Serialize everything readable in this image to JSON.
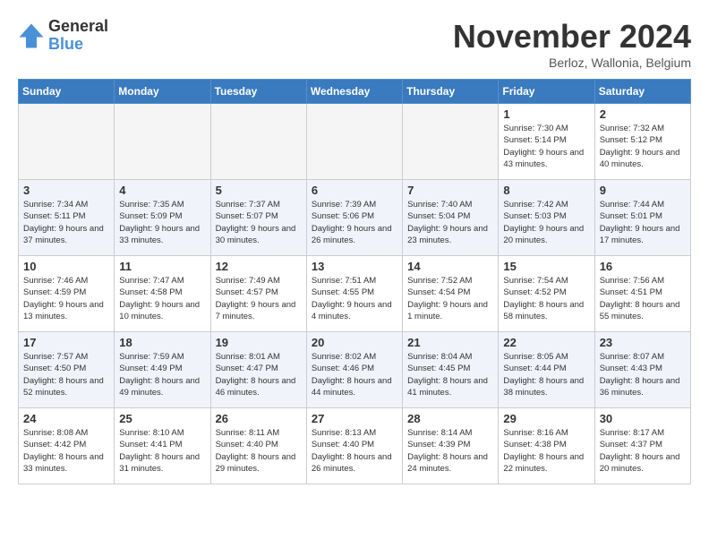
{
  "logo": {
    "general": "General",
    "blue": "Blue"
  },
  "title": {
    "month_year": "November 2024",
    "location": "Berloz, Wallonia, Belgium"
  },
  "weekdays": [
    "Sunday",
    "Monday",
    "Tuesday",
    "Wednesday",
    "Thursday",
    "Friday",
    "Saturday"
  ],
  "weeks": [
    [
      {
        "day": "",
        "empty": true
      },
      {
        "day": "",
        "empty": true
      },
      {
        "day": "",
        "empty": true
      },
      {
        "day": "",
        "empty": true
      },
      {
        "day": "",
        "empty": true
      },
      {
        "day": "1",
        "sunrise": "7:30 AM",
        "sunset": "5:14 PM",
        "daylight": "9 hours and 43 minutes."
      },
      {
        "day": "2",
        "sunrise": "7:32 AM",
        "sunset": "5:12 PM",
        "daylight": "9 hours and 40 minutes."
      }
    ],
    [
      {
        "day": "3",
        "sunrise": "7:34 AM",
        "sunset": "5:11 PM",
        "daylight": "9 hours and 37 minutes."
      },
      {
        "day": "4",
        "sunrise": "7:35 AM",
        "sunset": "5:09 PM",
        "daylight": "9 hours and 33 minutes."
      },
      {
        "day": "5",
        "sunrise": "7:37 AM",
        "sunset": "5:07 PM",
        "daylight": "9 hours and 30 minutes."
      },
      {
        "day": "6",
        "sunrise": "7:39 AM",
        "sunset": "5:06 PM",
        "daylight": "9 hours and 26 minutes."
      },
      {
        "day": "7",
        "sunrise": "7:40 AM",
        "sunset": "5:04 PM",
        "daylight": "9 hours and 23 minutes."
      },
      {
        "day": "8",
        "sunrise": "7:42 AM",
        "sunset": "5:03 PM",
        "daylight": "9 hours and 20 minutes."
      },
      {
        "day": "9",
        "sunrise": "7:44 AM",
        "sunset": "5:01 PM",
        "daylight": "9 hours and 17 minutes."
      }
    ],
    [
      {
        "day": "10",
        "sunrise": "7:46 AM",
        "sunset": "4:59 PM",
        "daylight": "9 hours and 13 minutes."
      },
      {
        "day": "11",
        "sunrise": "7:47 AM",
        "sunset": "4:58 PM",
        "daylight": "9 hours and 10 minutes."
      },
      {
        "day": "12",
        "sunrise": "7:49 AM",
        "sunset": "4:57 PM",
        "daylight": "9 hours and 7 minutes."
      },
      {
        "day": "13",
        "sunrise": "7:51 AM",
        "sunset": "4:55 PM",
        "daylight": "9 hours and 4 minutes."
      },
      {
        "day": "14",
        "sunrise": "7:52 AM",
        "sunset": "4:54 PM",
        "daylight": "9 hours and 1 minute."
      },
      {
        "day": "15",
        "sunrise": "7:54 AM",
        "sunset": "4:52 PM",
        "daylight": "8 hours and 58 minutes."
      },
      {
        "day": "16",
        "sunrise": "7:56 AM",
        "sunset": "4:51 PM",
        "daylight": "8 hours and 55 minutes."
      }
    ],
    [
      {
        "day": "17",
        "sunrise": "7:57 AM",
        "sunset": "4:50 PM",
        "daylight": "8 hours and 52 minutes."
      },
      {
        "day": "18",
        "sunrise": "7:59 AM",
        "sunset": "4:49 PM",
        "daylight": "8 hours and 49 minutes."
      },
      {
        "day": "19",
        "sunrise": "8:01 AM",
        "sunset": "4:47 PM",
        "daylight": "8 hours and 46 minutes."
      },
      {
        "day": "20",
        "sunrise": "8:02 AM",
        "sunset": "4:46 PM",
        "daylight": "8 hours and 44 minutes."
      },
      {
        "day": "21",
        "sunrise": "8:04 AM",
        "sunset": "4:45 PM",
        "daylight": "8 hours and 41 minutes."
      },
      {
        "day": "22",
        "sunrise": "8:05 AM",
        "sunset": "4:44 PM",
        "daylight": "8 hours and 38 minutes."
      },
      {
        "day": "23",
        "sunrise": "8:07 AM",
        "sunset": "4:43 PM",
        "daylight": "8 hours and 36 minutes."
      }
    ],
    [
      {
        "day": "24",
        "sunrise": "8:08 AM",
        "sunset": "4:42 PM",
        "daylight": "8 hours and 33 minutes."
      },
      {
        "day": "25",
        "sunrise": "8:10 AM",
        "sunset": "4:41 PM",
        "daylight": "8 hours and 31 minutes."
      },
      {
        "day": "26",
        "sunrise": "8:11 AM",
        "sunset": "4:40 PM",
        "daylight": "8 hours and 29 minutes."
      },
      {
        "day": "27",
        "sunrise": "8:13 AM",
        "sunset": "4:40 PM",
        "daylight": "8 hours and 26 minutes."
      },
      {
        "day": "28",
        "sunrise": "8:14 AM",
        "sunset": "4:39 PM",
        "daylight": "8 hours and 24 minutes."
      },
      {
        "day": "29",
        "sunrise": "8:16 AM",
        "sunset": "4:38 PM",
        "daylight": "8 hours and 22 minutes."
      },
      {
        "day": "30",
        "sunrise": "8:17 AM",
        "sunset": "4:37 PM",
        "daylight": "8 hours and 20 minutes."
      }
    ]
  ]
}
